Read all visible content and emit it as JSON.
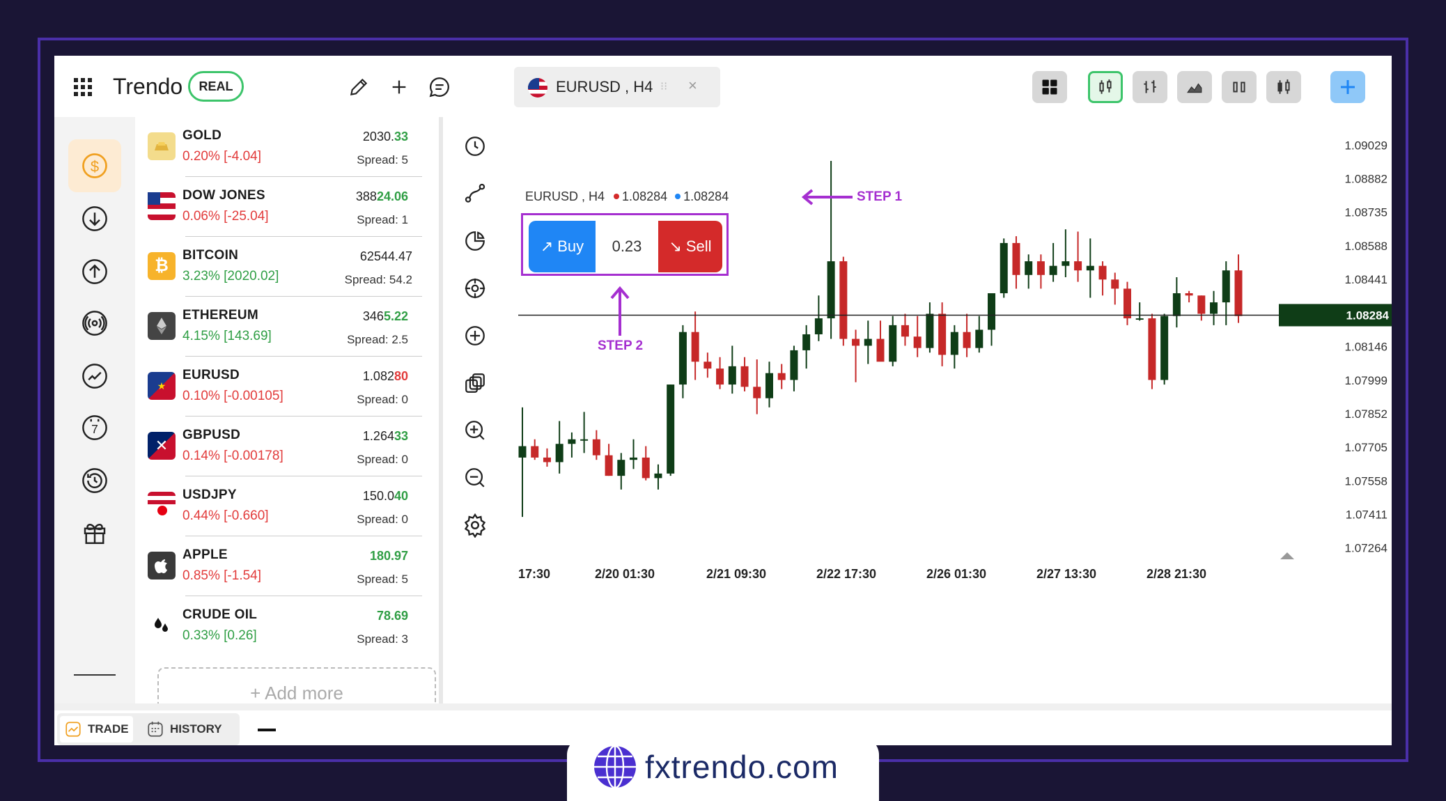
{
  "topbar": {
    "brand": "Trendo",
    "account_badge": "REAL",
    "symbol_tab": "EURUSD , H4"
  },
  "watchlist": {
    "items": [
      {
        "name": "GOLD",
        "change": "0.20% [-4.04]",
        "price_main": "2030.",
        "price_hl": "33",
        "spread": "Spread: 5",
        "dir": "down"
      },
      {
        "name": "DOW JONES",
        "change": "0.06% [-25.04]",
        "price_main": "388",
        "price_hl": "24.06",
        "spread": "Spread: 1",
        "dir": "down"
      },
      {
        "name": "BITCOIN",
        "change": "3.23% [2020.02]",
        "price_main": "62544.47",
        "price_hl": "",
        "spread": "Spread: 54.2",
        "dir": "up"
      },
      {
        "name": "ETHEREUM",
        "change": "4.15% [143.69]",
        "price_main": "346",
        "price_hl": "5.22",
        "spread": "Spread: 2.5",
        "dir": "up"
      },
      {
        "name": "EURUSD",
        "change": "0.10% [-0.00105]",
        "price_main": "1.082",
        "price_hl": "80",
        "spread": "Spread: 0",
        "dir": "down"
      },
      {
        "name": "GBPUSD",
        "change": "0.14% [-0.00178]",
        "price_main": "1.264",
        "price_hl": "33",
        "spread": "Spread: 0",
        "dir": "down"
      },
      {
        "name": "USDJPY",
        "change": "0.44% [-0.660]",
        "price_main": "150.0",
        "price_hl": "40",
        "spread": "Spread: 0",
        "dir": "down"
      },
      {
        "name": "APPLE",
        "change": "0.85% [-1.54]",
        "price_main": "",
        "price_hl": "180.97",
        "spread": "Spread: 5",
        "dir": "down"
      },
      {
        "name": "CRUDE OIL",
        "change": "0.33% [0.26]",
        "price_main": "",
        "price_hl": "78.69",
        "spread": "Spread: 3",
        "dir": "up"
      }
    ],
    "add_more": "+ Add more"
  },
  "chart": {
    "legend_symbol": "EURUSD , H4",
    "legend_bid": "1.08284",
    "legend_ask": "1.08284",
    "buy_label": "Buy",
    "quantity": "0.23",
    "sell_label": "Sell",
    "step1": "STEP 1",
    "step2": "STEP 2",
    "current_price": "1.08284",
    "price_labels": [
      "1.09029",
      "1.08882",
      "1.08735",
      "1.08588",
      "1.08441",
      "1.08146",
      "1.07999",
      "1.07852",
      "1.07705",
      "1.07558",
      "1.07411",
      "1.07264"
    ],
    "time_labels": [
      "17:30",
      "2/20 01:30",
      "2/21 09:30",
      "2/22 17:30",
      "2/26 01:30",
      "2/27 13:30",
      "2/28 21:30"
    ],
    "colors": {
      "up": "#0f3d17",
      "down": "#c62828",
      "buy": "#1f86f5",
      "sell": "#d42a2a",
      "annotation": "#a52fd0"
    }
  },
  "chart_data": {
    "type": "candlestick",
    "ylim": [
      1.0726,
      1.0903
    ],
    "current": 1.08284,
    "candles": [
      [
        1.0766,
        1.0788,
        1.074,
        1.0771
      ],
      [
        1.0771,
        1.0774,
        1.0765,
        1.0766
      ],
      [
        1.0766,
        1.077,
        1.0762,
        1.0764
      ],
      [
        1.0764,
        1.0782,
        1.0759,
        1.0772
      ],
      [
        1.0772,
        1.0777,
        1.0766,
        1.0774
      ],
      [
        1.0774,
        1.0786,
        1.0768,
        1.0774
      ],
      [
        1.0774,
        1.0778,
        1.0765,
        1.0767
      ],
      [
        1.0767,
        1.0772,
        1.0758,
        1.0758
      ],
      [
        1.0758,
        1.0768,
        1.0752,
        1.0765
      ],
      [
        1.0765,
        1.0774,
        1.0761,
        1.0766
      ],
      [
        1.0766,
        1.0771,
        1.0756,
        1.0757
      ],
      [
        1.0757,
        1.0763,
        1.0752,
        1.0759
      ],
      [
        1.0759,
        1.0798,
        1.0758,
        1.0798
      ],
      [
        1.0798,
        1.0824,
        1.0792,
        1.0821
      ],
      [
        1.0821,
        1.083,
        1.08,
        1.0808
      ],
      [
        1.0808,
        1.0812,
        1.0801,
        1.0805
      ],
      [
        1.0805,
        1.081,
        1.0796,
        1.0798
      ],
      [
        1.0798,
        1.0815,
        1.0794,
        1.0806
      ],
      [
        1.0806,
        1.081,
        1.0795,
        1.0797
      ],
      [
        1.0797,
        1.0809,
        1.0785,
        1.0792
      ],
      [
        1.0792,
        1.0808,
        1.0788,
        1.0803
      ],
      [
        1.0803,
        1.0807,
        1.0796,
        1.08
      ],
      [
        1.08,
        1.0815,
        1.0795,
        1.0813
      ],
      [
        1.0813,
        1.0824,
        1.0805,
        1.082
      ],
      [
        1.082,
        1.0837,
        1.0817,
        1.0827
      ],
      [
        1.0827,
        1.0896,
        1.0818,
        1.0852
      ],
      [
        1.0852,
        1.0854,
        1.0815,
        1.0818
      ],
      [
        1.0818,
        1.0822,
        1.0799,
        1.0815
      ],
      [
        1.0815,
        1.0826,
        1.0807,
        1.0818
      ],
      [
        1.0818,
        1.0826,
        1.081,
        1.0808
      ],
      [
        1.0808,
        1.0828,
        1.0806,
        1.0824
      ],
      [
        1.0824,
        1.0829,
        1.0815,
        1.0819
      ],
      [
        1.0819,
        1.0828,
        1.081,
        1.0814
      ],
      [
        1.0814,
        1.0834,
        1.0812,
        1.0829
      ],
      [
        1.0829,
        1.0834,
        1.0806,
        1.0811
      ],
      [
        1.0811,
        1.0824,
        1.0805,
        1.0821
      ],
      [
        1.0821,
        1.0829,
        1.081,
        1.0814
      ],
      [
        1.0814,
        1.0828,
        1.0812,
        1.0822
      ],
      [
        1.0822,
        1.0838,
        1.0815,
        1.0838
      ],
      [
        1.0838,
        1.0862,
        1.0836,
        1.086
      ],
      [
        1.086,
        1.0863,
        1.084,
        1.0846
      ],
      [
        1.0846,
        1.0855,
        1.084,
        1.0852
      ],
      [
        1.0852,
        1.0855,
        1.084,
        1.0846
      ],
      [
        1.0846,
        1.086,
        1.0843,
        1.085
      ],
      [
        1.085,
        1.0866,
        1.0845,
        1.0852
      ],
      [
        1.0852,
        1.0865,
        1.0843,
        1.0848
      ],
      [
        1.0848,
        1.0862,
        1.0836,
        1.085
      ],
      [
        1.085,
        1.0852,
        1.0837,
        1.0844
      ],
      [
        1.0844,
        1.0847,
        1.0833,
        1.084
      ],
      [
        1.084,
        1.0843,
        1.0824,
        1.0827
      ],
      [
        1.0827,
        1.0834,
        1.0826,
        1.0827
      ],
      [
        1.0827,
        1.0829,
        1.0796,
        1.08
      ],
      [
        1.08,
        1.0829,
        1.0798,
        1.0828
      ],
      [
        1.0828,
        1.0845,
        1.0823,
        1.0838
      ],
      [
        1.0838,
        1.0839,
        1.0834,
        1.0837
      ],
      [
        1.0837,
        1.0837,
        1.0826,
        1.0829
      ],
      [
        1.0829,
        1.0839,
        1.0824,
        1.0834
      ],
      [
        1.0834,
        1.0852,
        1.0824,
        1.0848
      ],
      [
        1.0848,
        1.0855,
        1.0825,
        1.0828
      ]
    ]
  }
}
